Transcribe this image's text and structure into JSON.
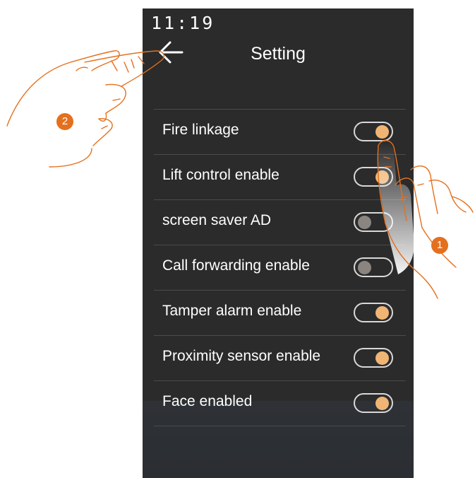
{
  "status_bar": {
    "time": "11:19"
  },
  "header": {
    "title": "Setting",
    "back_icon": "arrow-left-icon"
  },
  "settings": [
    {
      "label": "Fire linkage",
      "enabled": true
    },
    {
      "label": "Lift control enable",
      "enabled": true
    },
    {
      "label": "screen saver AD",
      "enabled": false
    },
    {
      "label": "Call forwarding enable",
      "enabled": false
    },
    {
      "label": "Tamper alarm enable",
      "enabled": true
    },
    {
      "label": "Proximity sensor enable",
      "enabled": true
    },
    {
      "label": "Face enabled",
      "enabled": true
    }
  ],
  "callouts": [
    {
      "number": "1"
    },
    {
      "number": "2"
    }
  ],
  "colors": {
    "accent": "#e4701e",
    "toggle_on": "#f0b574",
    "toggle_off": "#8a8580",
    "screen_bg": "#2b2b2b"
  }
}
